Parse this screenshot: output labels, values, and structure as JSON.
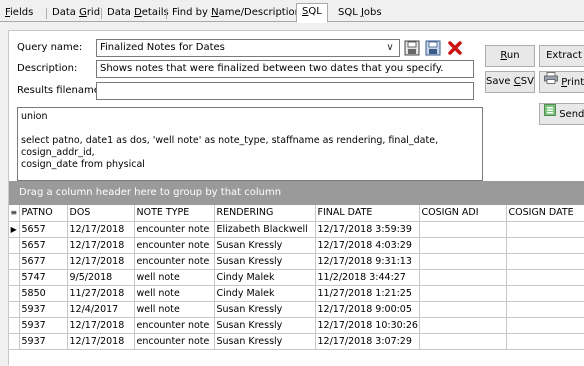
{
  "tabs": [
    {
      "label": "Fields",
      "u": "F"
    },
    {
      "label": "Data Grid",
      "u": "G"
    },
    {
      "label": "Data Details",
      "u": "D"
    },
    {
      "label": "Find by Name/Description",
      "u": "N"
    },
    {
      "label": "SQL",
      "u": "S"
    },
    {
      "label": "SQL Jobs",
      "u": "J"
    }
  ],
  "form": {
    "query_name_label": "Query name:",
    "query_name_value": "Finalized Notes for Dates",
    "description_label": "Description:",
    "description_value": "Shows notes that were finalized between two dates that you specify.",
    "results_label": "Results filename:",
    "results_value": ""
  },
  "buttons": {
    "run": "Run",
    "extract": "Extract",
    "save_csv": "Save CSV",
    "print": "Print",
    "send": "Send"
  },
  "sql_text": "union\n\nselect patno, date1 as dos, 'well note' as note_type, staffname as rendering, final_date, cosign_addr_id,\ncosign_date from physical",
  "group_hint": "Drag a column header here to group by that column",
  "grid": {
    "columns": [
      "PATNO",
      "DOS",
      "NOTE TYPE",
      "RENDERING",
      "FINAL DATE",
      "COSIGN ADI",
      "COSIGN DATE"
    ],
    "rows": [
      [
        "5657",
        "12/17/2018",
        "encounter note",
        "Elizabeth Blackwell",
        "12/17/2018 3:59:39",
        "",
        ""
      ],
      [
        "5657",
        "12/17/2018",
        "encounter note",
        "Susan Kressly",
        "12/17/2018 4:03:29",
        "",
        ""
      ],
      [
        "5677",
        "12/17/2018",
        "encounter note",
        "Susan Kressly",
        "12/17/2018 9:31:13",
        "",
        ""
      ],
      [
        "5747",
        "9/5/2018",
        "well note",
        "Cindy Malek",
        "11/2/2018 3:44:27",
        "",
        ""
      ],
      [
        "5850",
        "11/27/2018",
        "well note",
        "Cindy Malek",
        "11/27/2018 1:21:25",
        "",
        ""
      ],
      [
        "5937",
        "12/4/2017",
        "well note",
        "Susan Kressly",
        "12/17/2018 9:00:05",
        "",
        ""
      ],
      [
        "5937",
        "12/17/2018",
        "encounter note",
        "Susan Kressly",
        "12/17/2018 10:30:26",
        "",
        ""
      ],
      [
        "5937",
        "12/17/2018",
        "encounter note",
        "Susan Kressly",
        "12/17/2018 3:07:29",
        "",
        ""
      ]
    ],
    "selected_row": 0
  }
}
